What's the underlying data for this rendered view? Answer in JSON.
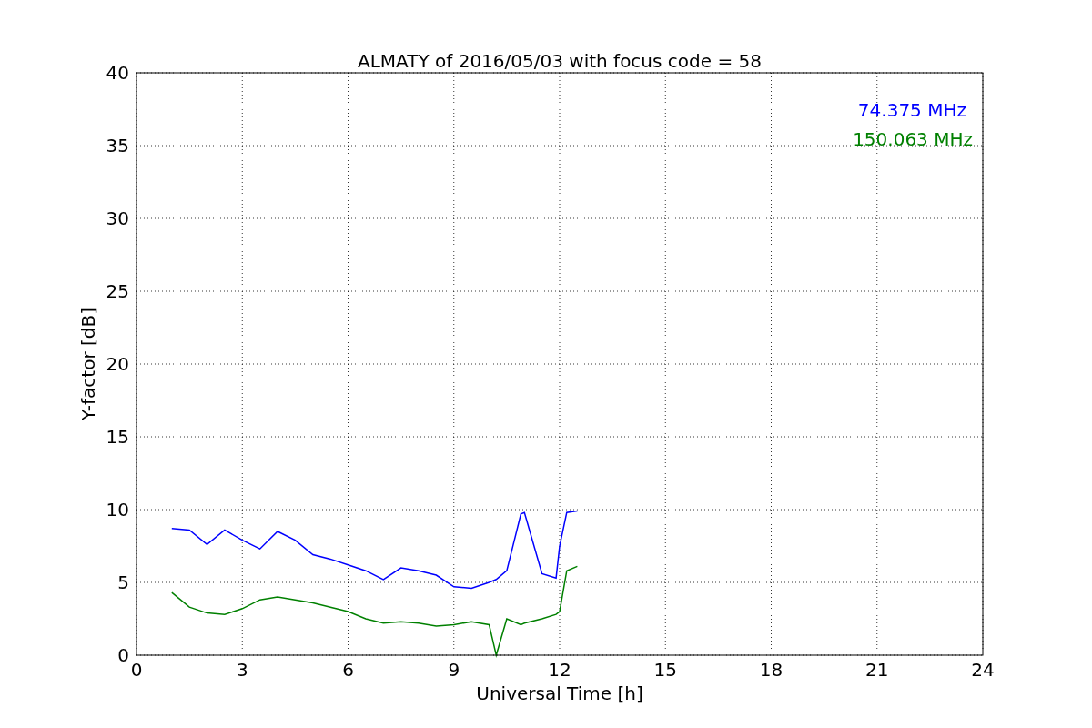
{
  "figure": {
    "chart_data": {
      "type": "line",
      "title": "ALMATY of 2016/05/03 with focus code = 58",
      "xlabel": "Universal Time [h]",
      "ylabel": "Y-factor [dB]",
      "xlim": [
        0,
        24
      ],
      "ylim": [
        0,
        40
      ],
      "xticks": [
        0,
        3,
        6,
        9,
        12,
        15,
        18,
        21,
        24
      ],
      "yticks": [
        0,
        5,
        10,
        15,
        20,
        25,
        30,
        35,
        40
      ],
      "grid": true,
      "x": [
        1,
        1.5,
        2,
        2.5,
        3,
        3.5,
        4,
        4.5,
        5,
        5.5,
        6,
        6.5,
        7,
        7.5,
        8,
        8.5,
        9,
        9.5,
        10,
        10.2,
        10.5,
        10.9,
        11,
        11.5,
        11.9,
        12,
        12.2,
        12.5
      ],
      "series": [
        {
          "name": "74.375 MHz",
          "color": "#0000ff",
          "values": [
            8.7,
            8.6,
            7.6,
            8.6,
            7.9,
            7.3,
            8.5,
            7.9,
            6.9,
            6.6,
            6.2,
            5.8,
            5.2,
            6.0,
            5.8,
            5.5,
            4.7,
            4.6,
            5.0,
            5.2,
            5.8,
            9.7,
            9.8,
            5.6,
            5.3,
            7.5,
            9.8,
            9.9
          ]
        },
        {
          "name": "150.063 MHz",
          "color": "#008000",
          "values": [
            4.3,
            3.3,
            2.9,
            2.8,
            3.2,
            3.8,
            4.0,
            3.8,
            3.6,
            3.3,
            3.0,
            2.5,
            2.2,
            2.3,
            2.2,
            2.0,
            2.1,
            2.3,
            2.1,
            0,
            2.5,
            2.1,
            2.2,
            2.5,
            2.8,
            3.0,
            5.8,
            6.1
          ]
        }
      ]
    }
  }
}
